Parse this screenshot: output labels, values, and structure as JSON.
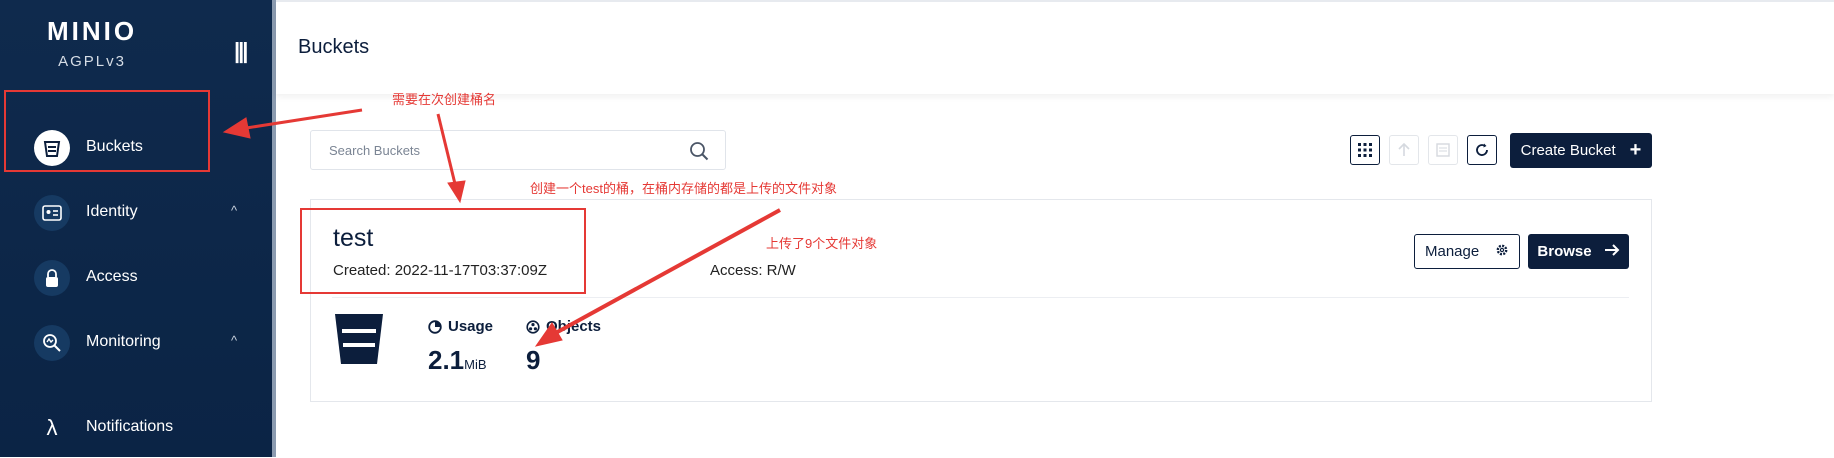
{
  "app": {
    "logo": "MINIO",
    "license": "AGPLv3"
  },
  "sidebar": {
    "items": [
      {
        "label": "Buckets",
        "icon": "bucket-icon",
        "active": true
      },
      {
        "label": "Identity",
        "icon": "id-card-icon",
        "chevron": "^"
      },
      {
        "label": "Access",
        "icon": "lock-icon"
      },
      {
        "label": "Monitoring",
        "icon": "monitor-search-icon",
        "chevron": "^"
      },
      {
        "label": "Notifications",
        "icon": "lambda-icon"
      }
    ]
  },
  "header": {
    "title": "Buckets"
  },
  "search": {
    "placeholder": "Search Buckets"
  },
  "toolbar": {
    "create_label": "Create Bucket"
  },
  "bucket": {
    "name": "test",
    "created": "Created: 2022-11-17T03:37:09Z",
    "access": "Access: R/W",
    "manage_label": "Manage",
    "browse_label": "Browse",
    "usage_label": "Usage",
    "usage_value": "2.1",
    "usage_unit": "MiB",
    "objects_label": "Objects",
    "objects_value": "9"
  },
  "annotations": {
    "note1": "需要在次创建桶名",
    "note2": "创建一个test的桶，在桶内存储的都是上传的文件对象",
    "note3": "上传了9个文件对象"
  },
  "colors": {
    "sidebar": "#0f2a4d",
    "primary": "#0c1e3c",
    "annotation": "#e53935"
  }
}
